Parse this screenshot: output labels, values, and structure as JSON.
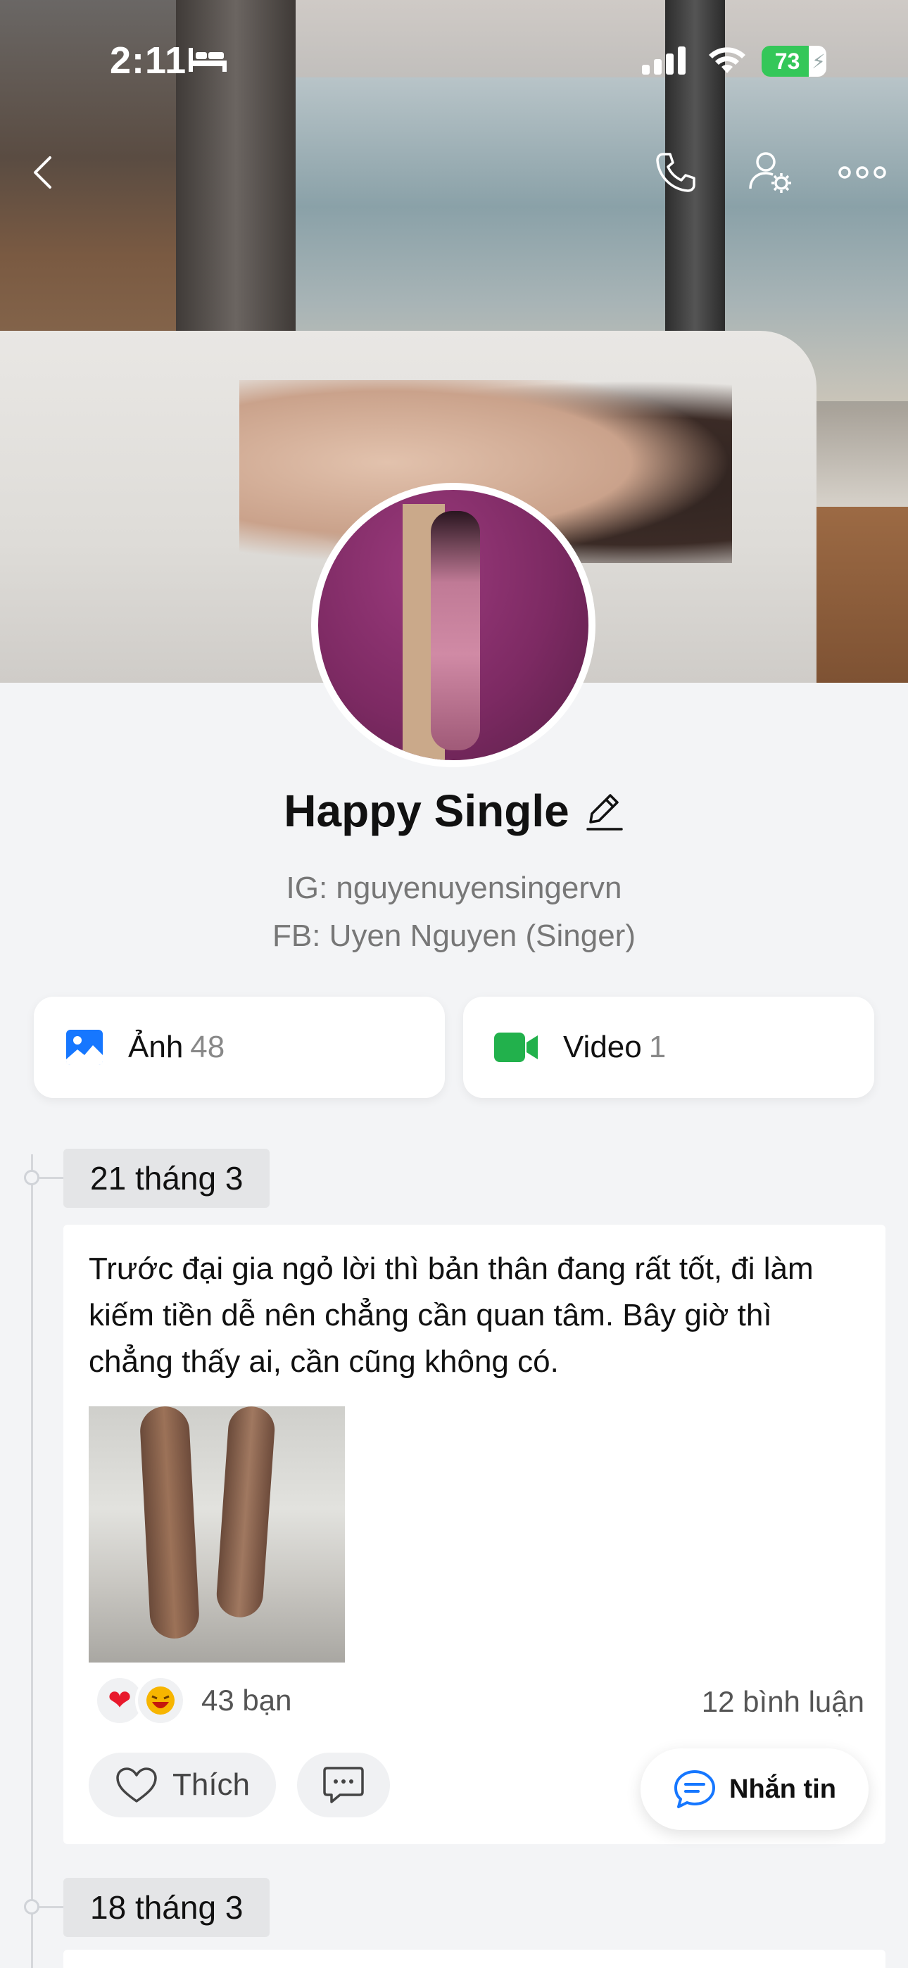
{
  "status_bar": {
    "time": "2:11",
    "battery": "73"
  },
  "profile": {
    "name": "Happy Single",
    "bio_lines": [
      "IG: nguyenuyensingervn",
      "FB: Uyen Nguyen (Singer)"
    ]
  },
  "media": {
    "photos": {
      "label": "Ảnh",
      "count": "48"
    },
    "videos": {
      "label": "Video",
      "count": "1"
    }
  },
  "timeline": [
    {
      "date": "21 tháng 3",
      "text": "Trước đại gia ngỏ lời thì bản thân đang rất tốt, đi làm kiếm tiền dễ nên chẳng cần quan tâm. Bây giờ thì chẳng thấy ai, cần cũng không có.",
      "reactions": [
        "heart",
        "laugh"
      ],
      "reaction_count": "43 bạn",
      "comment_count": "12 bình luận",
      "like_label": "Thích"
    },
    {
      "date": "18 tháng 3"
    }
  ],
  "message_button": "Nhắn tin",
  "colors": {
    "photo_icon": "#1677ff",
    "video_icon": "#22b14c",
    "message_icon": "#1677ff",
    "battery": "#34c759"
  }
}
